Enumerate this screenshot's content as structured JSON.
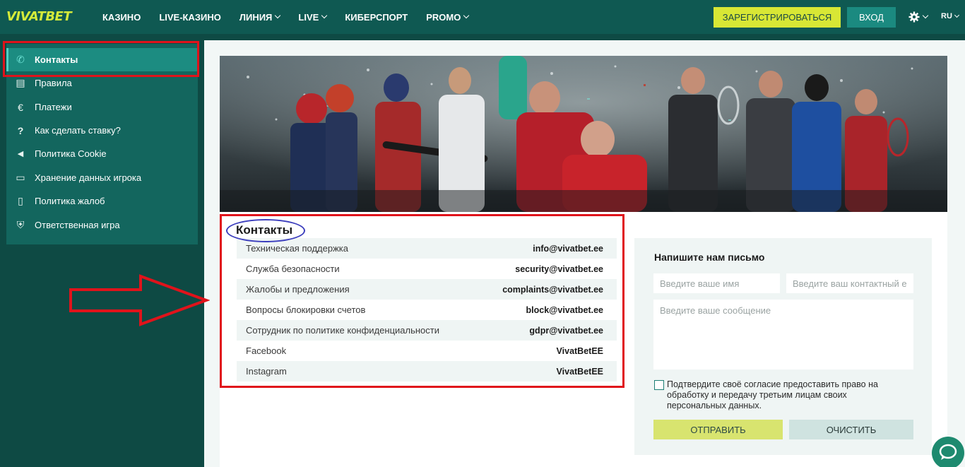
{
  "header": {
    "logo": "VIVATBET",
    "nav": [
      {
        "label": "КАЗИНО",
        "dropdown": false
      },
      {
        "label": "LIVE-КАЗИНО",
        "dropdown": false
      },
      {
        "label": "ЛИНИЯ",
        "dropdown": true
      },
      {
        "label": "LIVE",
        "dropdown": true
      },
      {
        "label": "КИБЕРСПОРТ",
        "dropdown": false
      },
      {
        "label": "PROMO",
        "dropdown": true
      }
    ],
    "register_label": "ЗАРЕГИСТРИРОВАТЬСЯ",
    "login_label": "ВХОД",
    "settings_icon": "gear-icon",
    "language": "RU"
  },
  "sidebar": {
    "items": [
      {
        "label": "Контакты",
        "icon": "phone-icon",
        "glyph": "✆",
        "active": true
      },
      {
        "label": "Правила",
        "icon": "document-icon",
        "glyph": "▤",
        "active": false
      },
      {
        "label": "Платежи",
        "icon": "euro-icon",
        "glyph": "€",
        "active": false
      },
      {
        "label": "Как сделать ставку?",
        "icon": "question-icon",
        "glyph": "?",
        "active": false
      },
      {
        "label": "Политика Cookie",
        "icon": "megaphone-icon",
        "glyph": "◀",
        "active": false
      },
      {
        "label": "Хранение данных игрока",
        "icon": "folder-icon",
        "glyph": "▭",
        "active": false
      },
      {
        "label": "Политика жалоб",
        "icon": "file-icon",
        "glyph": "▯",
        "active": false
      },
      {
        "label": "Ответственная игра",
        "icon": "shield-icon",
        "glyph": "⛨",
        "active": false
      }
    ]
  },
  "contacts": {
    "title": "Контакты",
    "rows": [
      {
        "label": "Техническая поддержка",
        "value": "info@vivatbet.ee"
      },
      {
        "label": "Служба безопасности",
        "value": "security@vivatbet.ee"
      },
      {
        "label": "Жалобы и предложения",
        "value": "complaints@vivatbet.ee"
      },
      {
        "label": "Вопросы блокировки счетов",
        "value": "block@vivatbet.ee"
      },
      {
        "label": "Сотрудник по политике конфиденциальности",
        "value": "gdpr@vivatbet.ee"
      },
      {
        "label": "Facebook",
        "value": "VivatBetEE"
      },
      {
        "label": "Instagram",
        "value": "VivatBetEE"
      }
    ]
  },
  "form": {
    "title": "Напишите нам письмо",
    "name_placeholder": "Введите ваше имя",
    "contact_placeholder": "Введите ваш контактный е",
    "message_placeholder": "Введите ваше сообщение",
    "consent": "Подтвердите своё согласие предоставить право на обработку и передачу третьим лицам своих персональных данных.",
    "send_label": "ОТПРАВИТЬ",
    "clear_label": "ОЧИСТИТЬ"
  },
  "colors": {
    "header_bg": "#0f5952",
    "accent_lime": "#d8e735",
    "annotation_red": "#e0131b",
    "annotation_blue": "#3d3fbd"
  }
}
